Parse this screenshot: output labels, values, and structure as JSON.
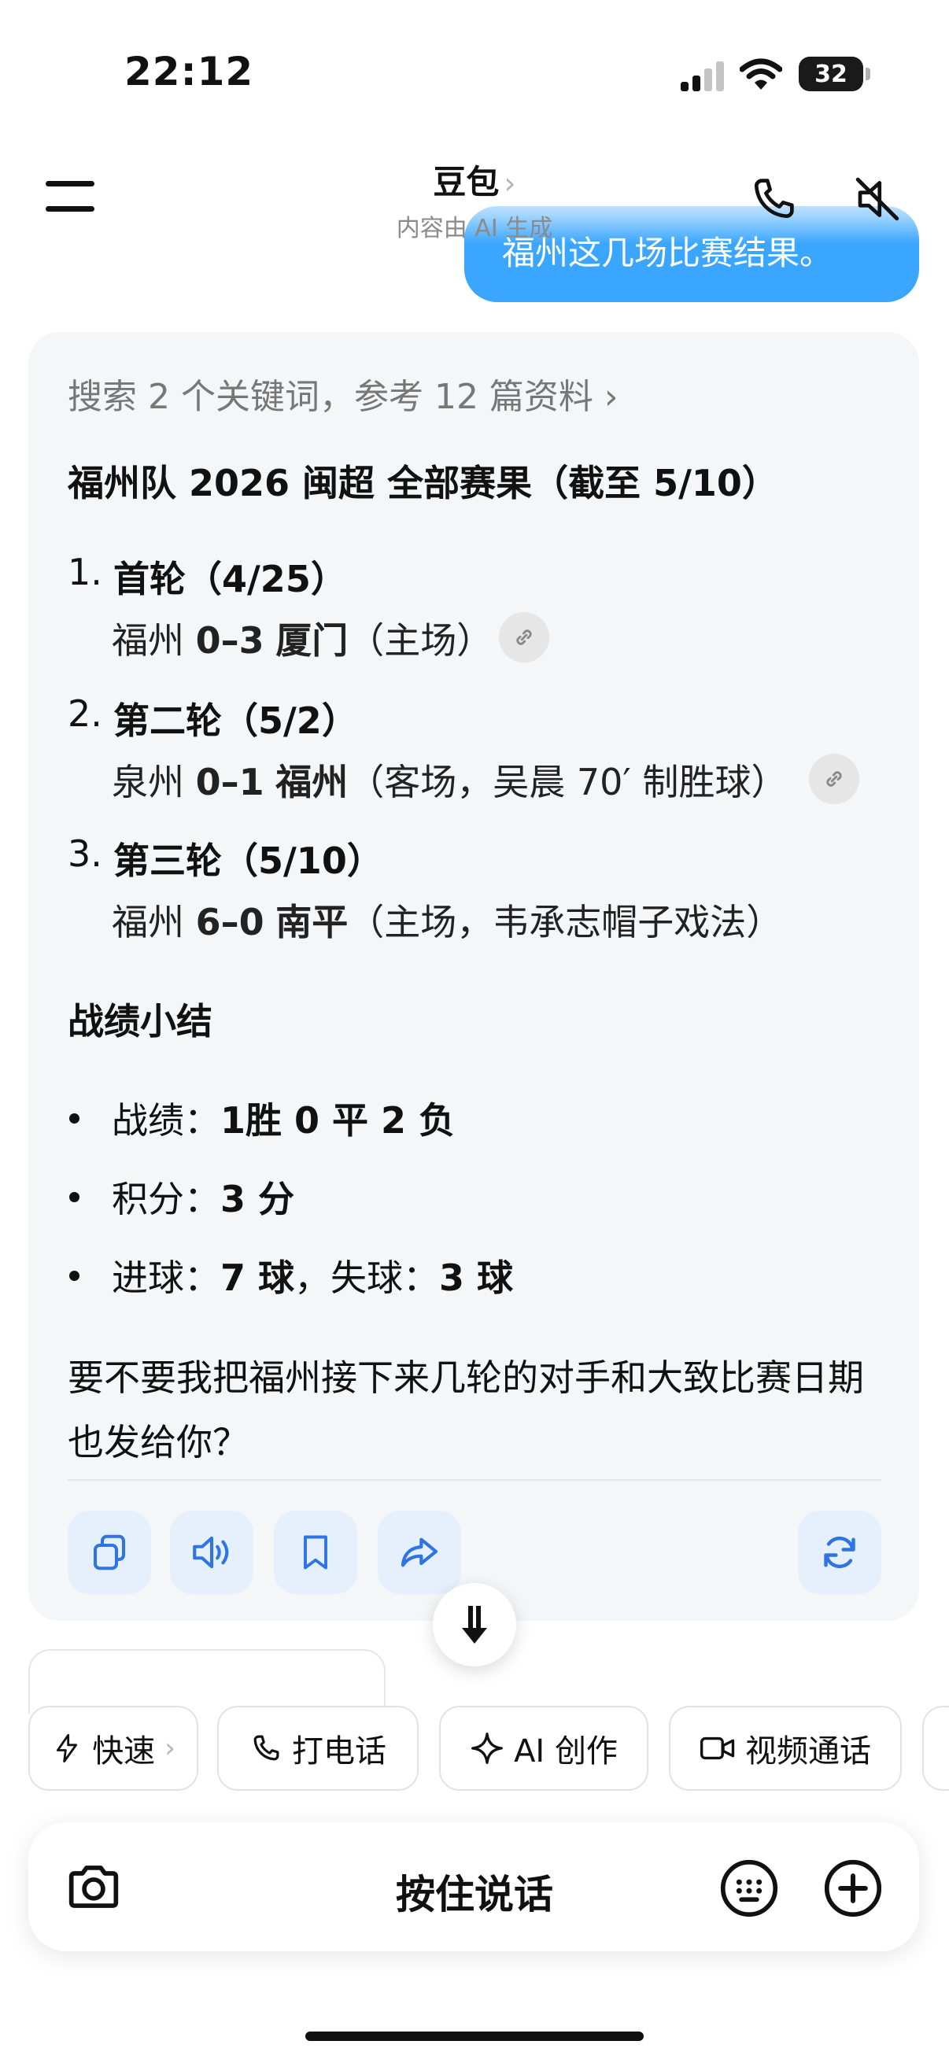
{
  "status_bar": {
    "time": "22:12",
    "battery": "32"
  },
  "header": {
    "title": "豆包",
    "subtitle": "内容由 AI 生成"
  },
  "user_message": {
    "text": "福州这几场比赛结果。"
  },
  "answer": {
    "search_ref": "搜索 2 个关键词，参考 12 篇资料 ›",
    "heading": "福州队 2026 闽超 全部赛果（截至 5/10）",
    "items": [
      {
        "num": "1.",
        "title": "首轮（4/25）",
        "team_a": "福州",
        "score": "0–3",
        "team_b": "厦门",
        "note": "（主场）"
      },
      {
        "num": "2.",
        "title": "第二轮（5/2）",
        "team_a": "泉州",
        "score": "0–1",
        "team_b": "福州",
        "note": "（客场，吴晨 70′ 制胜球）"
      },
      {
        "num": "3.",
        "title": "第三轮（5/10）",
        "team_a": "福州",
        "score": "6–0",
        "team_b": "南平",
        "note": "（主场，韦承志帽子戏法）"
      }
    ],
    "summary_title": "战绩小结",
    "summary": [
      {
        "label": "战绩：",
        "value": "1胜 0 平 2 负"
      },
      {
        "label": "积分：",
        "value": "3 分"
      },
      {
        "label": "进球：",
        "value": "7 球",
        "label2": "，失球：",
        "value2": "3 球"
      }
    ],
    "closing": "要不要我把福州接下来几轮的对手和大致比赛日期也发给你？"
  },
  "quick_actions": {
    "fast": "快速",
    "call": "打电话",
    "ai_create": "AI 创作",
    "video_call": "视频通话"
  },
  "input_bar": {
    "hold_to_talk": "按住说话"
  },
  "colors": {
    "accent": "#3aa6ff",
    "action_bg": "#e6f0fc",
    "icon_blue": "#2f74e5",
    "card_bg": "#f5f6f7"
  }
}
